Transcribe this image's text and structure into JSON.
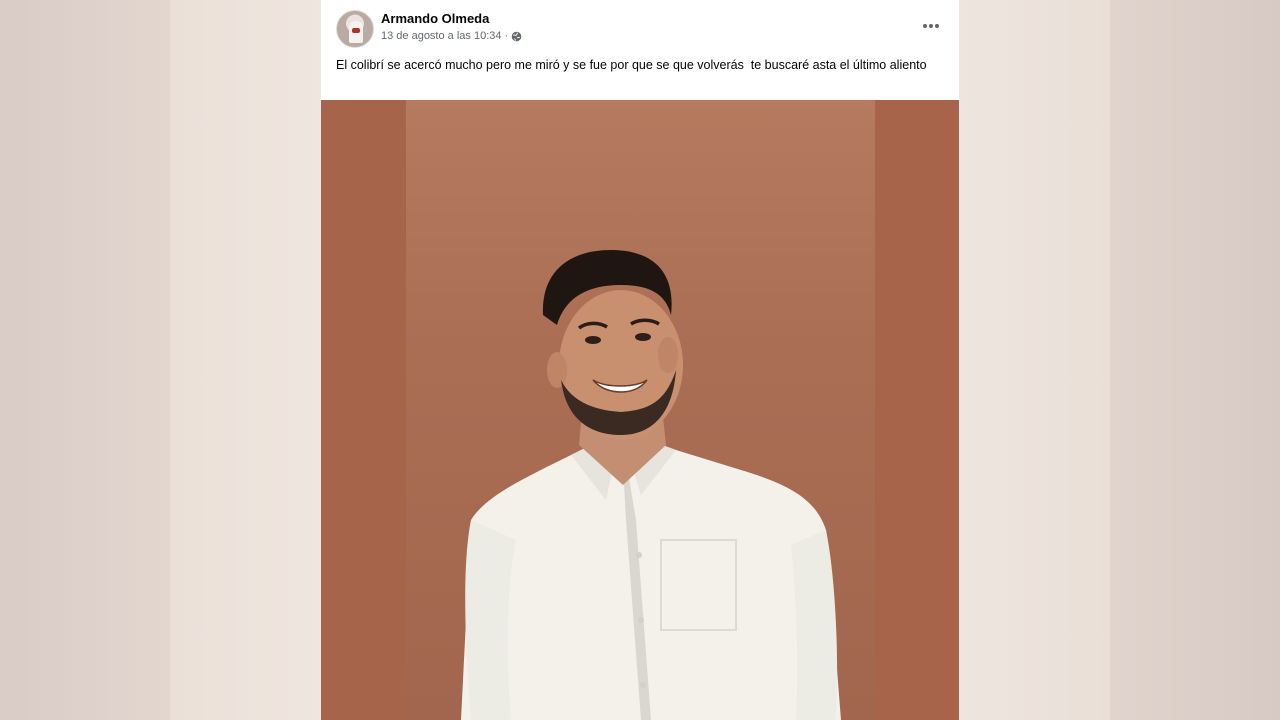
{
  "post": {
    "author": "Armando Olmeda",
    "timestamp": "13 de agosto a las 10:34",
    "separator": "·",
    "privacy_icon": "globe-icon",
    "more_icon": "more-horizontal-icon",
    "text": "El colibrí se acercó mucho pero me miró y se fue por que se que volverás  te buscaré asta el último aliento"
  },
  "colors": {
    "wall": "#a8654a",
    "shirt": "#f3f1ea",
    "page_background": "#e8ddd5"
  }
}
